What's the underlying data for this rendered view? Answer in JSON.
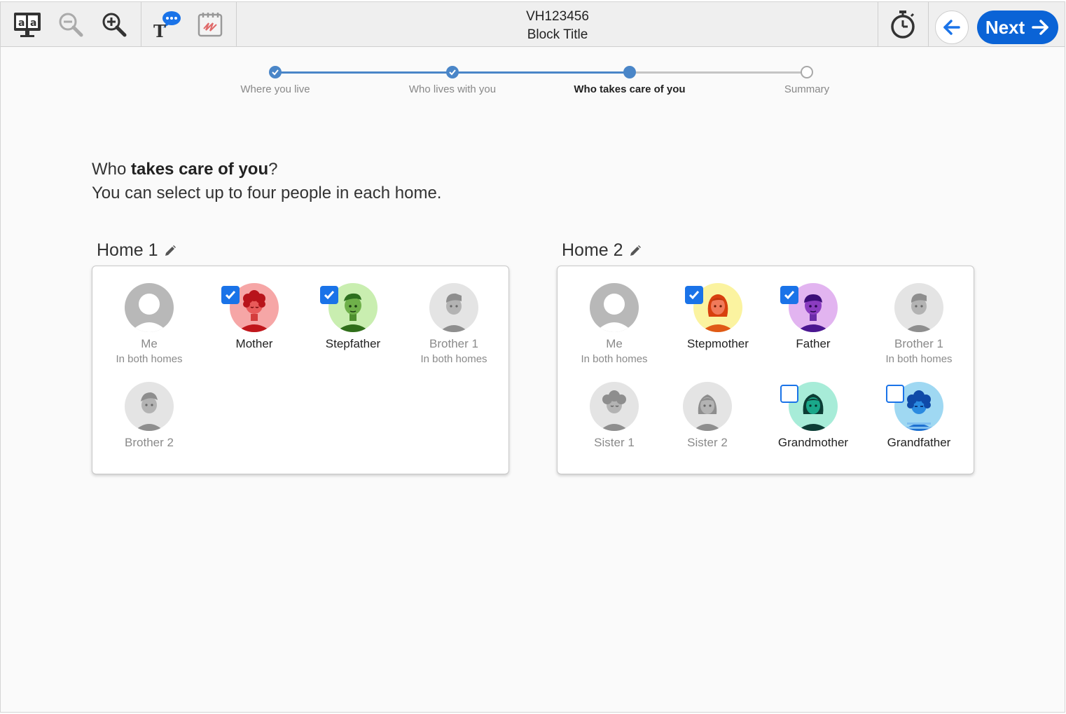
{
  "header": {
    "code": "VH123456",
    "block_title": "Block Title",
    "next_label": "Next"
  },
  "toolbar_icons": [
    "text-to-speech-icon",
    "zoom-out-icon",
    "zoom-in-icon",
    "text-help-icon",
    "scratchwork-icon",
    "timer-icon",
    "back-arrow-icon",
    "next-arrow-icon"
  ],
  "stepper": {
    "steps": [
      {
        "label": "Where you live",
        "state": "done"
      },
      {
        "label": "Who lives with you",
        "state": "done"
      },
      {
        "label": "Who takes care of you",
        "state": "current"
      },
      {
        "label": "Summary",
        "state": "todo"
      }
    ]
  },
  "prompt": {
    "line1_pre": "Who ",
    "line1_bold": "takes care of you",
    "line1_post": "?",
    "line2": "You can select up to four people in each home."
  },
  "homes": [
    {
      "title": "Home 1",
      "people": [
        {
          "name": "Me",
          "sub": "In both homes",
          "checkbox": "none",
          "enabled": false
        },
        {
          "name": "Mother",
          "sub": "",
          "checkbox": "checked",
          "enabled": true
        },
        {
          "name": "Stepfather",
          "sub": "",
          "checkbox": "checked",
          "enabled": true
        },
        {
          "name": "Brother 1",
          "sub": "In both homes",
          "checkbox": "none",
          "enabled": false
        },
        {
          "name": "Brother 2",
          "sub": "",
          "checkbox": "none",
          "enabled": false
        }
      ]
    },
    {
      "title": "Home 2",
      "people": [
        {
          "name": "Me",
          "sub": "In both homes",
          "checkbox": "none",
          "enabled": false
        },
        {
          "name": "Stepmother",
          "sub": "",
          "checkbox": "checked",
          "enabled": true
        },
        {
          "name": "Father",
          "sub": "",
          "checkbox": "checked",
          "enabled": true
        },
        {
          "name": "Brother 1",
          "sub": "In both homes",
          "checkbox": "none",
          "enabled": false
        },
        {
          "name": "Sister 1",
          "sub": "",
          "checkbox": "none",
          "enabled": false
        },
        {
          "name": "Sister 2",
          "sub": "",
          "checkbox": "none",
          "enabled": false
        },
        {
          "name": "Grandmother",
          "sub": "",
          "checkbox": "unchecked",
          "enabled": true
        },
        {
          "name": "Grandfather",
          "sub": "",
          "checkbox": "unchecked",
          "enabled": true
        }
      ]
    }
  ],
  "colors": {
    "accent": "#1a73e8",
    "next_button": "#0a63d6",
    "mother_bg": "#f6a6a6",
    "stepfather_bg": "#c9eeb0",
    "stepmother_bg": "#fbf3a0",
    "father_bg": "#e2b4f0",
    "grandmother_bg": "#a7ecd8",
    "grandfather_bg": "#9fd8f2",
    "disabled_bg": "#e4e4e4"
  }
}
